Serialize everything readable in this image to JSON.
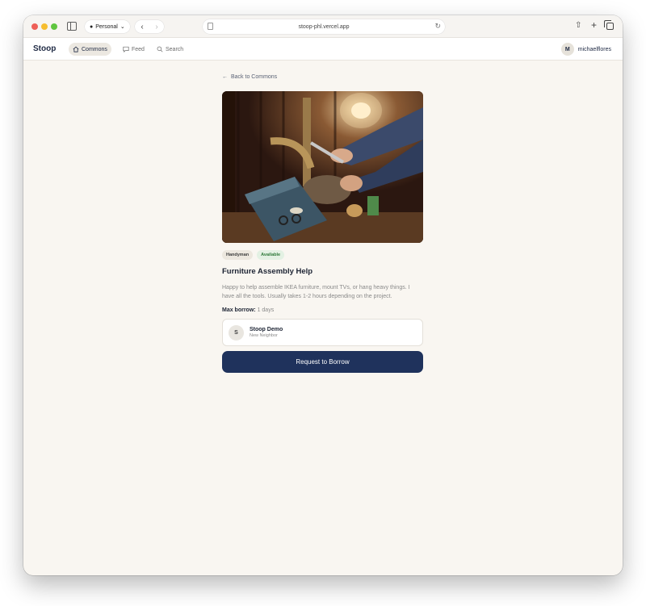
{
  "browser": {
    "profile": "Personal",
    "url": "stoop-phl.vercel.app"
  },
  "nav": {
    "brand": "Stoop",
    "items": [
      {
        "label": "Commons",
        "icon": "home-icon"
      },
      {
        "label": "Feed",
        "icon": "chat-icon"
      },
      {
        "label": "Search",
        "icon": "search-icon"
      }
    ],
    "user": {
      "initial": "M",
      "username": "michaelflores"
    }
  },
  "detail": {
    "back_label": "Back to Commons",
    "photo_icon": "plumbing-photo",
    "category": "Handyman",
    "status": "Available",
    "title": "Furniture Assembly Help",
    "description": "Happy to help assemble IKEA furniture, mount TVs, or hang heavy things. I have all the tools. Usually takes 1-2 hours depending on the project.",
    "max_borrow_label": "Max borrow:",
    "max_borrow_value": "1 days",
    "owner": {
      "initial": "S",
      "name": "Stoop Demo",
      "role": "New Neighbor"
    },
    "request_label": "Request to Borrow"
  },
  "colors": {
    "primary": "#1f325c",
    "background": "#f9f6f1",
    "status_green": "#2f7a3a"
  }
}
